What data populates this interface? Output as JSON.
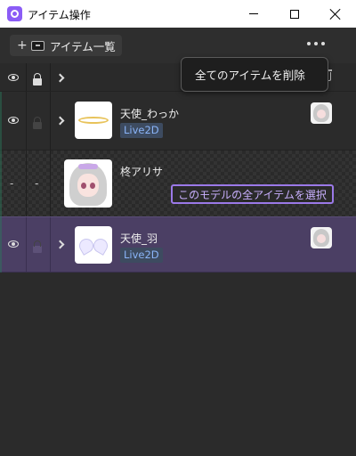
{
  "window": {
    "title": "アイテム操作",
    "icons": {
      "app": "app-logo-icon",
      "minimize": "minimize-icon",
      "maximize": "maximize-icon",
      "close": "close-icon"
    }
  },
  "toolbar": {
    "add_symbol": "+",
    "tab_label": "アイテム一覧",
    "icons": {
      "tab": "item-box-icon",
      "more": "more-horizontal-icon"
    }
  },
  "header": {
    "icons": {
      "visibility": "eye-icon",
      "lock": "unlock-icon",
      "expand": "chevron-right-icon",
      "delete": "trash-icon"
    }
  },
  "context_menu": {
    "delete_all_label": "全てのアイテムを削除"
  },
  "items": [
    {
      "name": "天使_わっか",
      "badge": "Live2D",
      "thumbnail": "halo-icon",
      "owner_icon": "avatar-icon",
      "visible": true,
      "locked": false,
      "selected": false
    },
    {
      "name": "柊アリサ",
      "visible_text": "-",
      "lock_text": "-",
      "thumbnail": "model-avatar",
      "action_label": "このモデルの全アイテムを選択"
    },
    {
      "name": "天使_羽",
      "badge": "Live2D",
      "thumbnail": "wings-icon",
      "owner_icon": "avatar-icon",
      "visible": true,
      "locked": false,
      "selected": true
    }
  ],
  "colors": {
    "selected_row": "#4b3f64",
    "badge_text": "#8ab4f8",
    "select_button_border": "#9b79e8",
    "app_icon": "#8b5cf6"
  }
}
